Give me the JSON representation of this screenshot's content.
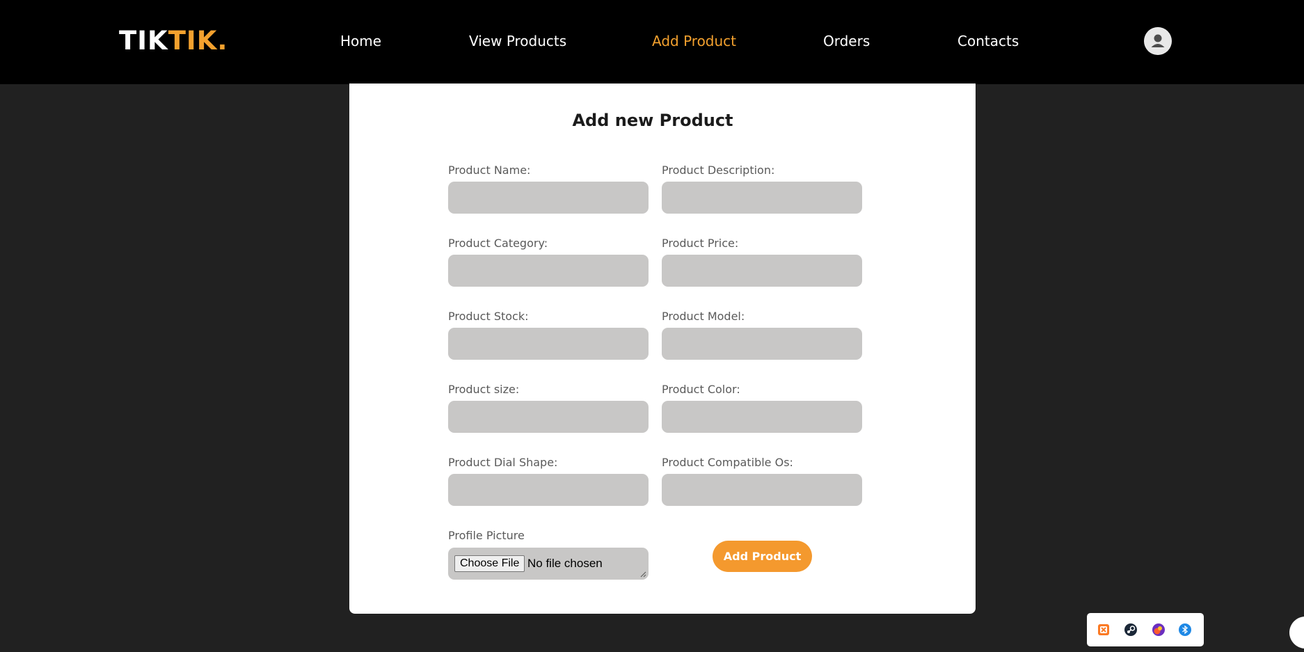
{
  "brand": {
    "part1": "TIK",
    "part2": "TIK."
  },
  "nav": {
    "items": [
      {
        "label": "Home"
      },
      {
        "label": "View Products"
      },
      {
        "label": "Add Product",
        "active": true
      },
      {
        "label": "Orders"
      },
      {
        "label": "Contacts"
      }
    ],
    "avatar_icon": "user-avatar-icon"
  },
  "form": {
    "title": "Add new Product",
    "fields": [
      {
        "label": "Product Name:",
        "value": ""
      },
      {
        "label": "Product Description:",
        "value": ""
      },
      {
        "label": "Product Category:",
        "value": ""
      },
      {
        "label": "Product Price:",
        "value": ""
      },
      {
        "label": "Product Stock:",
        "value": ""
      },
      {
        "label": "Product Model:",
        "value": ""
      },
      {
        "label": "Product size:",
        "value": ""
      },
      {
        "label": "Product Color:",
        "value": ""
      },
      {
        "label": "Product Dial Shape:",
        "value": ""
      },
      {
        "label": "Product Compatible Os:",
        "value": ""
      }
    ],
    "file": {
      "label": "Profile Picture",
      "button": "Choose File",
      "status": "No file chosen"
    },
    "submit": "Add Product"
  },
  "tray": {
    "icons": [
      "xampp-icon",
      "steam-icon",
      "app-icon",
      "bluetooth-icon"
    ]
  },
  "colors": {
    "accent": "#f4a12e",
    "button": "#f4992e",
    "navbar": "#000000",
    "background": "#212121",
    "input": "#c8c7c6"
  }
}
